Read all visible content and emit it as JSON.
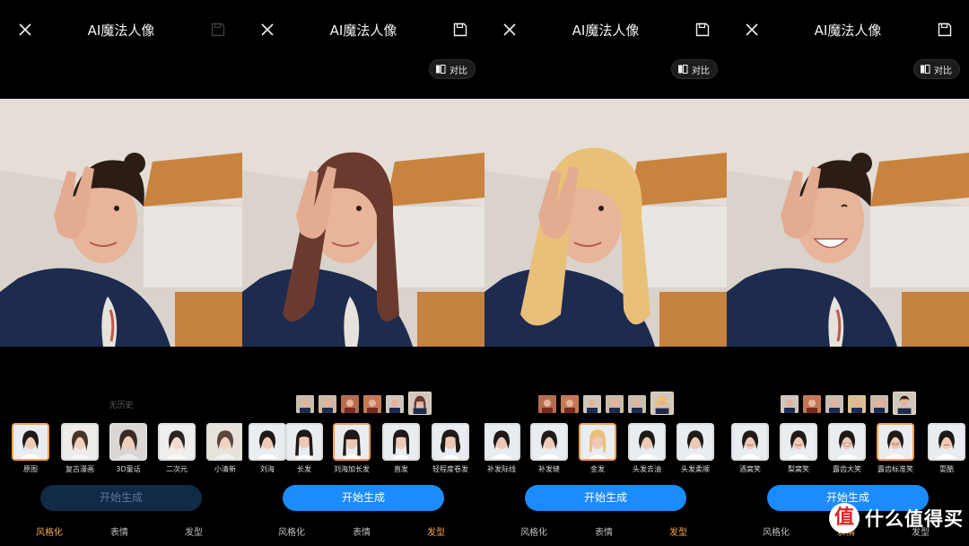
{
  "panels": [
    {
      "title": "AI魔法人像",
      "compare_label": "",
      "hair": "none",
      "history_label": "无历史",
      "generate_label": "开始生成",
      "tabs": [
        "风格化",
        "表情",
        "发型"
      ],
      "active_tab": 0,
      "styles": [
        "原图",
        "复古漫画",
        "3D童话",
        "二次元",
        "小清新",
        "刘海"
      ],
      "selected_style": 0
    },
    {
      "title": "AI魔法人像",
      "compare_label": "对比",
      "hair": "brown",
      "history_label": "",
      "generate_label": "开始生成",
      "tabs": [
        "风格化",
        "表情",
        "发型"
      ],
      "active_tab": 2,
      "styles": [
        "长发",
        "刘海加长发",
        "直发",
        "轻程度卷发"
      ],
      "selected_style": 1
    },
    {
      "title": "AI魔法人像",
      "compare_label": "对比",
      "hair": "blonde",
      "history_label": "",
      "generate_label": "开始生成",
      "tabs": [
        "风格化",
        "表情",
        "发型"
      ],
      "active_tab": 2,
      "styles": [
        "补发际线",
        "补发缝",
        "金发",
        "头发去油",
        "头发柔顺"
      ],
      "selected_style": 2
    },
    {
      "title": "AI魔法人像",
      "compare_label": "对比",
      "hair": "none",
      "history_label": "",
      "generate_label": "开始生成",
      "tabs": [
        "风格化",
        "表情",
        "发型"
      ],
      "active_tab": 1,
      "styles": [
        "酒窝笑",
        "梨窝笑",
        "露齿大笑",
        "露齿标准笑",
        "耍酷"
      ],
      "selected_style": 3
    }
  ],
  "watermark": {
    "logo": "值",
    "text": "什么值得买"
  },
  "colors": {
    "accent_orange": "#f3a14f",
    "primary_blue": "#1a8cff",
    "disabled_blue": "#0f2b48",
    "background": "#000000"
  },
  "icons": {
    "close": "close-icon",
    "save": "save-icon",
    "compare": "compare-icon"
  }
}
